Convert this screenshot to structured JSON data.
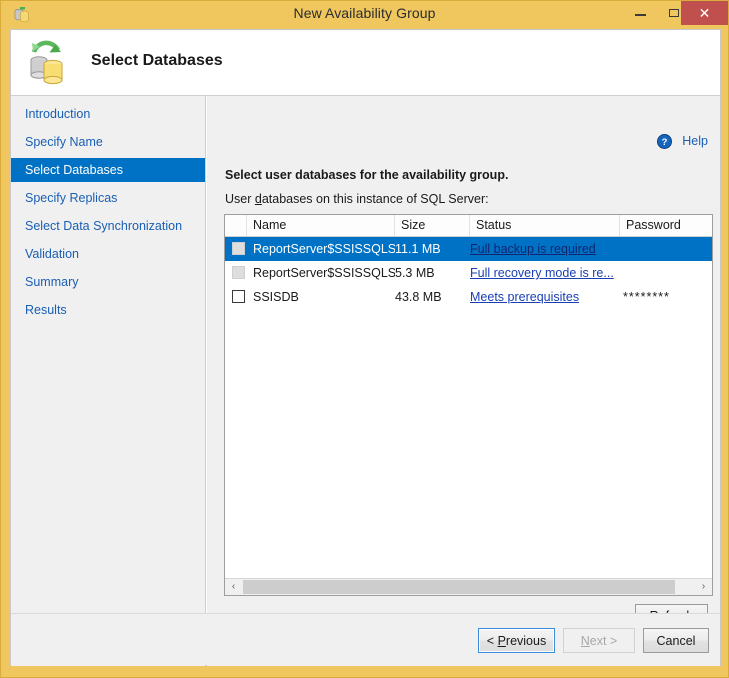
{
  "window": {
    "title": "New Availability Group",
    "icon": "database-icon",
    "minimize_label": "–",
    "maximize_label": "□",
    "close_label": "✕"
  },
  "header": {
    "title": "Select Databases",
    "icon": "database-sync-icon"
  },
  "sidebar": {
    "items": [
      {
        "label": "Introduction",
        "selected": false
      },
      {
        "label": "Specify Name",
        "selected": false
      },
      {
        "label": "Select Databases",
        "selected": true
      },
      {
        "label": "Specify Replicas",
        "selected": false
      },
      {
        "label": "Select Data Synchronization",
        "selected": false
      },
      {
        "label": "Validation",
        "selected": false
      },
      {
        "label": "Summary",
        "selected": false
      },
      {
        "label": "Results",
        "selected": false
      }
    ]
  },
  "content": {
    "help_label": "Help",
    "help_icon": "help-circle-icon",
    "instruction_bold": "Select user databases for the availability group.",
    "instruction_prefix": "User ",
    "instruction_accesskey": "d",
    "instruction_suffix": "atabases on this instance of SQL Server:",
    "refresh_label_prefix": "Re",
    "refresh_accesskey": "f",
    "refresh_label_suffix": "resh"
  },
  "table": {
    "columns": [
      "",
      "Name",
      "Size",
      "Status",
      "Password"
    ],
    "rows": [
      {
        "checked": false,
        "checkbox_state": "disabled",
        "name": "ReportServer$SSISSQLSER...",
        "size": "11.1 MB",
        "status": "Full backup is required",
        "password": "",
        "selected": true
      },
      {
        "checked": false,
        "checkbox_state": "disabled",
        "name": "ReportServer$SSISSQLSER...",
        "size": "5.3 MB",
        "status": "Full recovery mode is re...",
        "password": "",
        "selected": false
      },
      {
        "checked": false,
        "checkbox_state": "enabled",
        "name": "SSISDB",
        "size": "43.8 MB",
        "status": "Meets prerequisites",
        "password": "********",
        "selected": false
      }
    ]
  },
  "scrollbar": {
    "left_arrow": "‹",
    "right_arrow": "›"
  },
  "footer": {
    "previous_prefix": "< ",
    "previous_accesskey": "P",
    "previous_suffix": "revious",
    "next_prefix": "",
    "next_accesskey": "N",
    "next_suffix": "ext >",
    "cancel_label": "Cancel"
  },
  "colors": {
    "window_frame": "#efc75e",
    "accent_selection": "#0072c6",
    "link": "#1a5fb4",
    "close_button": "#c0504d"
  }
}
